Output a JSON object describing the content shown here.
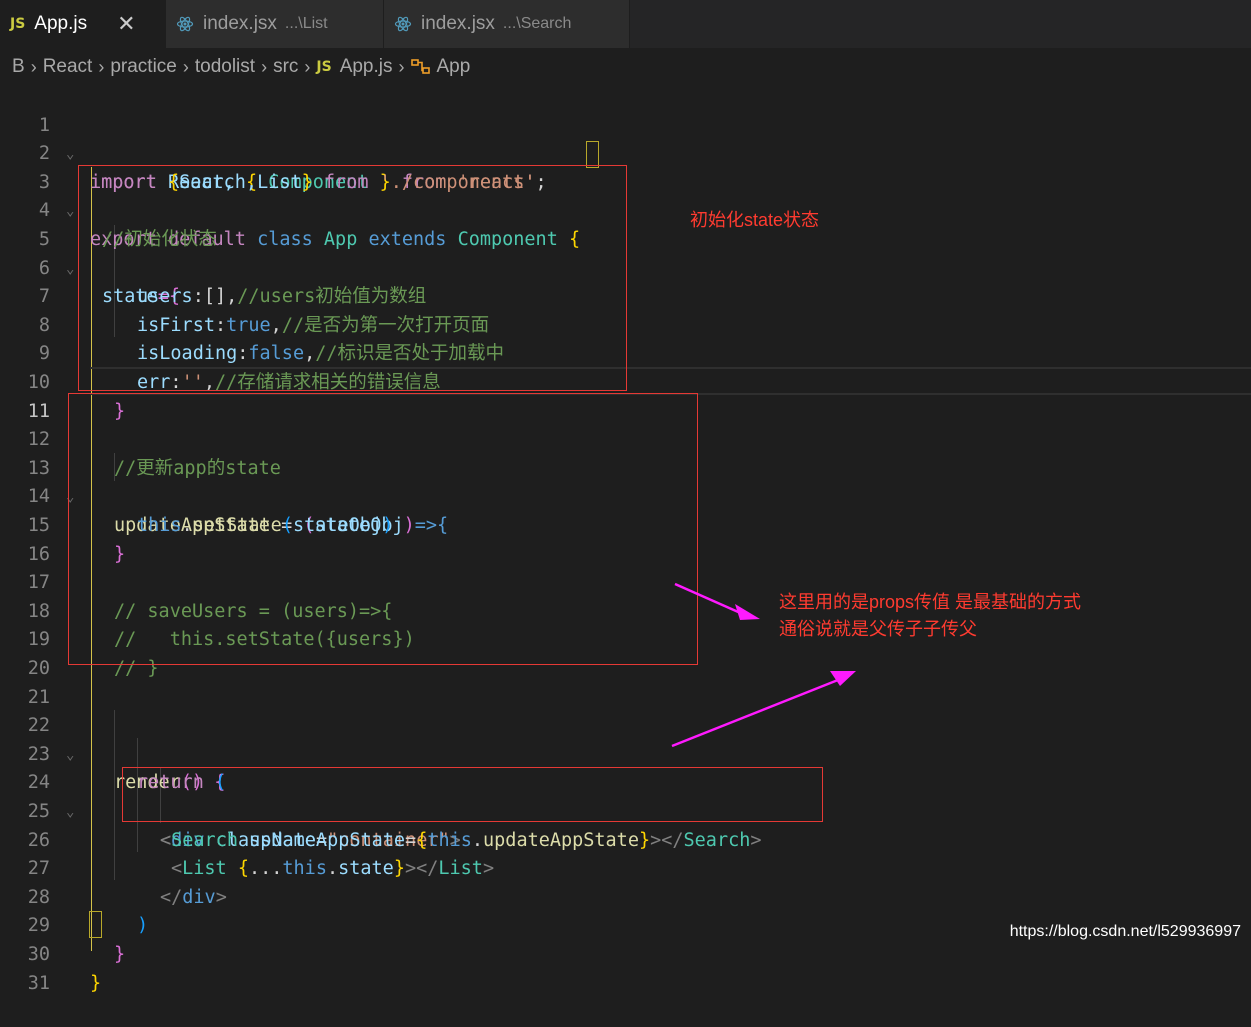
{
  "tabs": [
    {
      "icon": "JS",
      "label": "App.js",
      "path": "",
      "close": "✕"
    },
    {
      "icon": "react",
      "label": "index.jsx",
      "path": "...\\List"
    },
    {
      "icon": "react",
      "label": "index.jsx",
      "path": "...\\Search"
    }
  ],
  "breadcrumb": {
    "items": [
      "B",
      "React",
      "practice",
      "todolist",
      "src"
    ],
    "file_icon": "JS",
    "file": "App.js",
    "symbol": "App"
  },
  "line_numbers": [
    "1",
    "2",
    "3",
    "4",
    "5",
    "6",
    "7",
    "8",
    "9",
    "10",
    "11",
    "12",
    "13",
    "14",
    "15",
    "16",
    "17",
    "18",
    "19",
    "20",
    "21",
    "22",
    "23",
    "24",
    "25",
    "26",
    "27",
    "28",
    "29",
    "30",
    "31"
  ],
  "code": {
    "l1": [
      "import",
      " React, ",
      "{",
      " Component ",
      "}",
      " from ",
      "'react'"
    ],
    "l2": [
      "import",
      " {",
      "Search,List",
      "}",
      " from ",
      "'./components'",
      ";"
    ],
    "l3": [
      "export",
      " default ",
      "class",
      " App ",
      "extends",
      " Component ",
      "{"
    ],
    "l4": "//初始化状态",
    "l5": [
      "state",
      "={"
    ],
    "l6": [
      "users",
      ":[],",
      "//users初始值为数组"
    ],
    "l7": [
      "isFirst",
      ":",
      "true",
      ",",
      "//是否为第一次打开页面"
    ],
    "l8": [
      "isLoading",
      ":",
      "false",
      ",",
      "//标识是否处于加载中"
    ],
    "l9": [
      "err",
      ":",
      "''",
      ",",
      "//存储请求相关的错误信息"
    ],
    "l10": "}",
    "l12": "//更新app的state",
    "l13": [
      "updateAppState",
      " = ",
      "(",
      "stateObj",
      ")",
      "=>{"
    ],
    "l14": [
      "this",
      ".",
      "setState",
      "(",
      "stateObj",
      ")"
    ],
    "l15": "}",
    "l17": "// saveUsers = (users)=>{",
    "l18": "//   this.setState({users})",
    "l19": "// }",
    "l22": [
      "render",
      "()",
      " {"
    ],
    "l23": [
      "return",
      " ("
    ],
    "l24": [
      "<",
      "div",
      " ",
      "className",
      "=",
      "\"container\"",
      ">"
    ],
    "l25": [
      "<",
      "Search",
      " ",
      "updateAppState",
      "=",
      "{",
      "this",
      ".",
      "updateAppState",
      "}",
      "></",
      "Search",
      ">"
    ],
    "l26": [
      "<",
      "List",
      " ",
      "{",
      "...",
      "this",
      ".",
      "state",
      "}",
      "></",
      "List",
      ">"
    ],
    "l27": [
      "</",
      "div",
      ">"
    ],
    "l28": ")",
    "l29": "}",
    "l30": "}"
  },
  "annotations": {
    "state_note": "初始化state状态",
    "props_note_1": "这里用的是props传值 是最基础的方式",
    "props_note_2": "通俗说就是父传子子传父"
  },
  "watermark": "https://blog.csdn.net/l529936997",
  "colors": {
    "annotation": "#ff3b30",
    "arrow": "#ff1aff",
    "box": "#e53935"
  }
}
